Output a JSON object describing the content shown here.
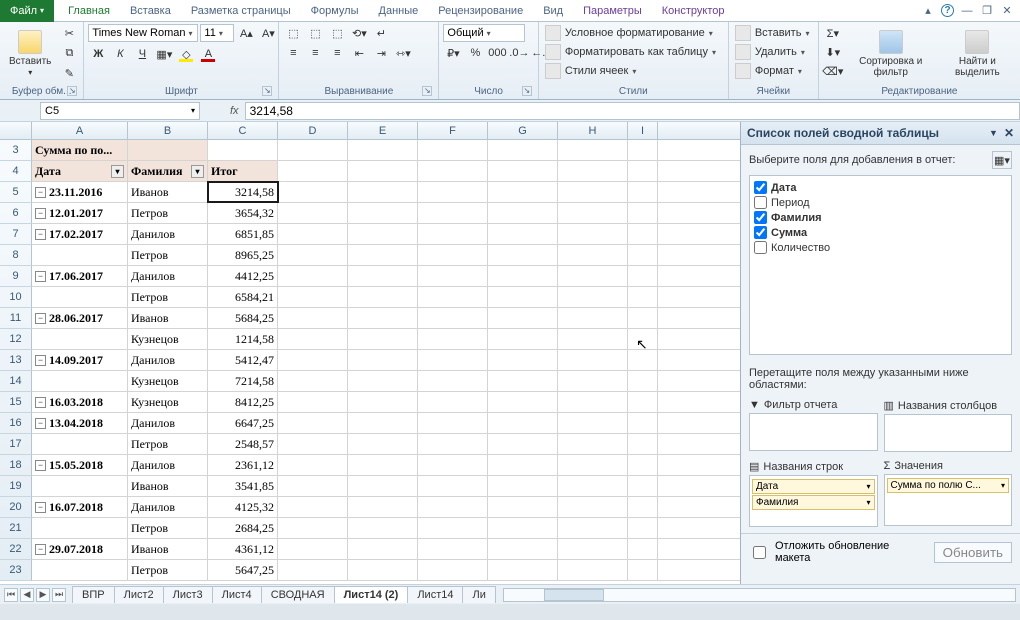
{
  "tabs": {
    "file": "Файл",
    "home": "Главная",
    "insert": "Вставка",
    "layout": "Разметка страницы",
    "formulas": "Формулы",
    "data": "Данные",
    "review": "Рецензирование",
    "view": "Вид",
    "parameters": "Параметры",
    "constructor": "Конструктор"
  },
  "ribbon": {
    "clipboard": {
      "paste": "Вставить",
      "label": "Буфер обм..."
    },
    "font": {
      "name": "Times New Roman",
      "size": "11",
      "label": "Шрифт"
    },
    "align": {
      "label": "Выравнивание"
    },
    "number": {
      "format": "Общий",
      "label": "Число"
    },
    "styles": {
      "cond": "Условное форматирование",
      "table": "Форматировать как таблицу",
      "cell": "Стили ячеек",
      "label": "Стили"
    },
    "cells": {
      "insert": "Вставить",
      "delete": "Удалить",
      "format": "Формат",
      "label": "Ячейки"
    },
    "editing": {
      "sort": "Сортировка и фильтр",
      "find": "Найти и выделить",
      "label": "Редактирование"
    }
  },
  "namebox": "C5",
  "formula": "3214,58",
  "columns": [
    "A",
    "B",
    "C",
    "D",
    "E",
    "F",
    "G",
    "H",
    "I"
  ],
  "row_start": 3,
  "pivot": {
    "title": "Сумма по по...",
    "h_date": "Дата",
    "h_fam": "Фамилия",
    "h_total": "Итог"
  },
  "rows": [
    {
      "r": 5,
      "d": "23.11.2016",
      "f": "Иванов",
      "v": "3214,58",
      "active": true,
      "coll": true
    },
    {
      "r": 6,
      "d": "12.01.2017",
      "f": "Петров",
      "v": "3654,32",
      "coll": true
    },
    {
      "r": 7,
      "d": "17.02.2017",
      "f": "Данилов",
      "v": "6851,85",
      "coll": true
    },
    {
      "r": 8,
      "d": "",
      "f": "Петров",
      "v": "8965,25"
    },
    {
      "r": 9,
      "d": "17.06.2017",
      "f": "Данилов",
      "v": "4412,25",
      "coll": true
    },
    {
      "r": 10,
      "d": "",
      "f": "Петров",
      "v": "6584,21"
    },
    {
      "r": 11,
      "d": "28.06.2017",
      "f": "Иванов",
      "v": "5684,25",
      "coll": true
    },
    {
      "r": 12,
      "d": "",
      "f": "Кузнецов",
      "v": "1214,58"
    },
    {
      "r": 13,
      "d": "14.09.2017",
      "f": "Данилов",
      "v": "5412,47",
      "coll": true
    },
    {
      "r": 14,
      "d": "",
      "f": "Кузнецов",
      "v": "7214,58"
    },
    {
      "r": 15,
      "d": "16.03.2018",
      "f": "Кузнецов",
      "v": "8412,25",
      "coll": true
    },
    {
      "r": 16,
      "d": "13.04.2018",
      "f": "Данилов",
      "v": "6647,25",
      "coll": true
    },
    {
      "r": 17,
      "d": "",
      "f": "Петров",
      "v": "2548,57"
    },
    {
      "r": 18,
      "d": "15.05.2018",
      "f": "Данилов",
      "v": "2361,12",
      "coll": true
    },
    {
      "r": 19,
      "d": "",
      "f": "Иванов",
      "v": "3541,85"
    },
    {
      "r": 20,
      "d": "16.07.2018",
      "f": "Данилов",
      "v": "4125,32",
      "coll": true
    },
    {
      "r": 21,
      "d": "",
      "f": "Петров",
      "v": "2684,25"
    },
    {
      "r": 22,
      "d": "29.07.2018",
      "f": "Иванов",
      "v": "4361,12",
      "coll": true
    },
    {
      "r": 23,
      "d": "",
      "f": "Петров",
      "v": "5647,25"
    }
  ],
  "fieldlist": {
    "title": "Список полей сводной таблицы",
    "prompt": "Выберите поля для добавления в отчет:",
    "fields": [
      {
        "name": "Дата",
        "checked": true,
        "bold": true
      },
      {
        "name": "Период",
        "checked": false,
        "bold": false
      },
      {
        "name": "Фамилия",
        "checked": true,
        "bold": true
      },
      {
        "name": "Сумма",
        "checked": true,
        "bold": true
      },
      {
        "name": "Количество",
        "checked": false,
        "bold": false
      }
    ],
    "drag_prompt": "Перетащите поля между указанными ниже областями:",
    "areas": {
      "filter": "Фильтр отчета",
      "cols": "Названия столбцов",
      "rows": "Названия строк",
      "vals": "Значения"
    },
    "row_chips": [
      "Дата",
      "Фамилия"
    ],
    "val_chip": "Сумма по полю С...",
    "defer": "Отложить обновление макета",
    "update": "Обновить"
  },
  "sheets": [
    "ВПР",
    "Лист2",
    "Лист3",
    "Лист4",
    "СВОДНАЯ",
    "Лист14 (2)",
    "Лист14",
    "Ли"
  ],
  "active_sheet": 5
}
